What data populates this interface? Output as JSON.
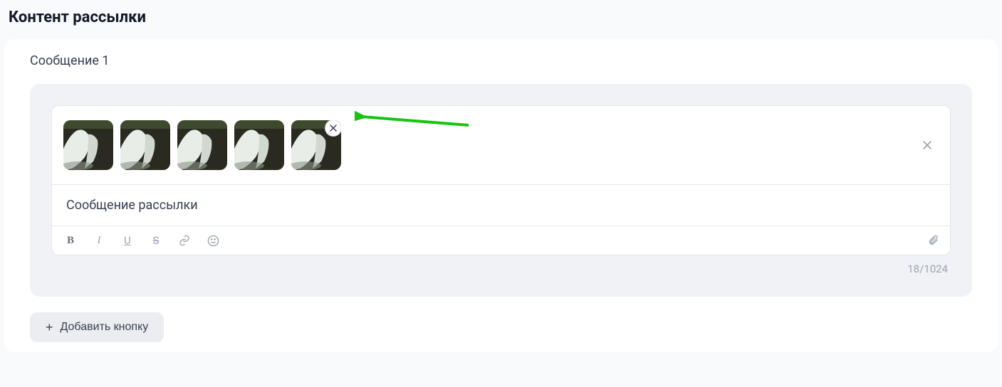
{
  "header": {
    "title": "Контент рассылки"
  },
  "message": {
    "label": "Сообщение 1",
    "text": "Сообщение рассылки",
    "char_count": "18/1024",
    "attachments_count": 5
  },
  "toolbar": {
    "bold": "B",
    "italic": "I",
    "underline": "U",
    "strike": "S"
  },
  "add_button": {
    "label": "Добавить кнопку"
  }
}
